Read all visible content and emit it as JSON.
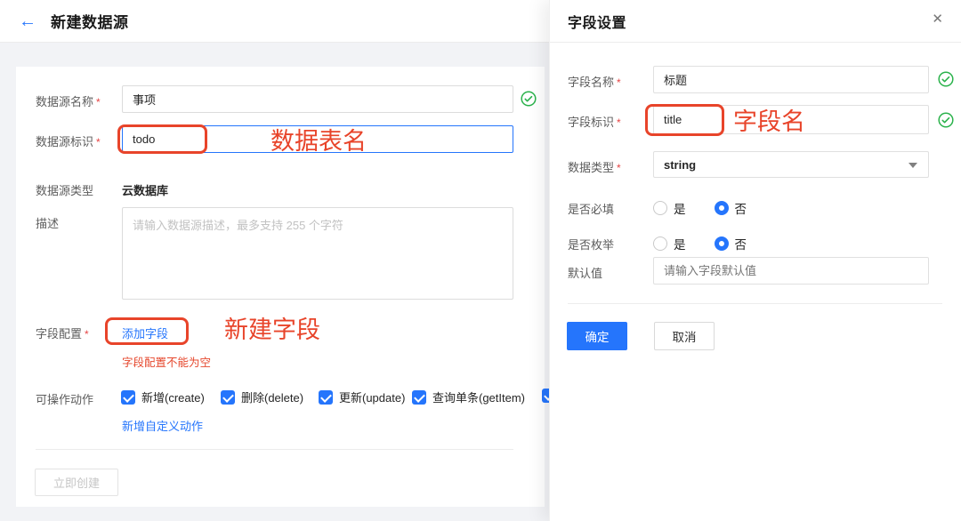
{
  "icons": {
    "back": "←",
    "close": "✕"
  },
  "colors": {
    "accent_blue": "#2575fc",
    "success_green": "#2ab24b",
    "annotation_red": "#e8442a",
    "error_red": "#e6492f"
  },
  "page": {
    "title": "新建数据源"
  },
  "form": {
    "name": {
      "label": "数据源名称",
      "required": "*",
      "value": "事项"
    },
    "identifier": {
      "label": "数据源标识",
      "required": "*",
      "value": "todo"
    },
    "type": {
      "label": "数据源类型",
      "value": "云数据库"
    },
    "description": {
      "label": "描述",
      "placeholder": "请输入数据源描述，最多支持 255 个字符"
    },
    "fields_config": {
      "label": "字段配置",
      "required": "*",
      "add_link": "添加字段",
      "error": "字段配置不能为空"
    },
    "actions": {
      "label": "可操作动作",
      "items": [
        {
          "label": "新增(create)",
          "checked": true
        },
        {
          "label": "删除(delete)",
          "checked": true
        },
        {
          "label": "更新(update)",
          "checked": true
        },
        {
          "label": "查询单条(getItem)",
          "checked": true
        },
        {
          "label": "",
          "checked": true
        }
      ],
      "custom_link": "新增自定义动作"
    },
    "submit_label": "立即创建"
  },
  "drawer": {
    "title": "字段设置",
    "field_name": {
      "label": "字段名称",
      "required": "*",
      "value": "标题"
    },
    "field_id": {
      "label": "字段标识",
      "required": "*",
      "value": "title"
    },
    "data_type": {
      "label": "数据类型",
      "required": "*",
      "value": "string"
    },
    "is_required": {
      "label": "是否必填",
      "options": [
        {
          "label": "是",
          "selected": false
        },
        {
          "label": "否",
          "selected": true
        }
      ]
    },
    "is_enum": {
      "label": "是否枚举",
      "options": [
        {
          "label": "是",
          "selected": false
        },
        {
          "label": "否",
          "selected": true
        }
      ]
    },
    "default_value": {
      "label": "默认值",
      "placeholder": "请输入字段默认值"
    },
    "ok_label": "确定",
    "cancel_label": "取消"
  },
  "annotations": {
    "table_name": "数据表名",
    "new_field": "新建字段",
    "field_name": "字段名"
  }
}
